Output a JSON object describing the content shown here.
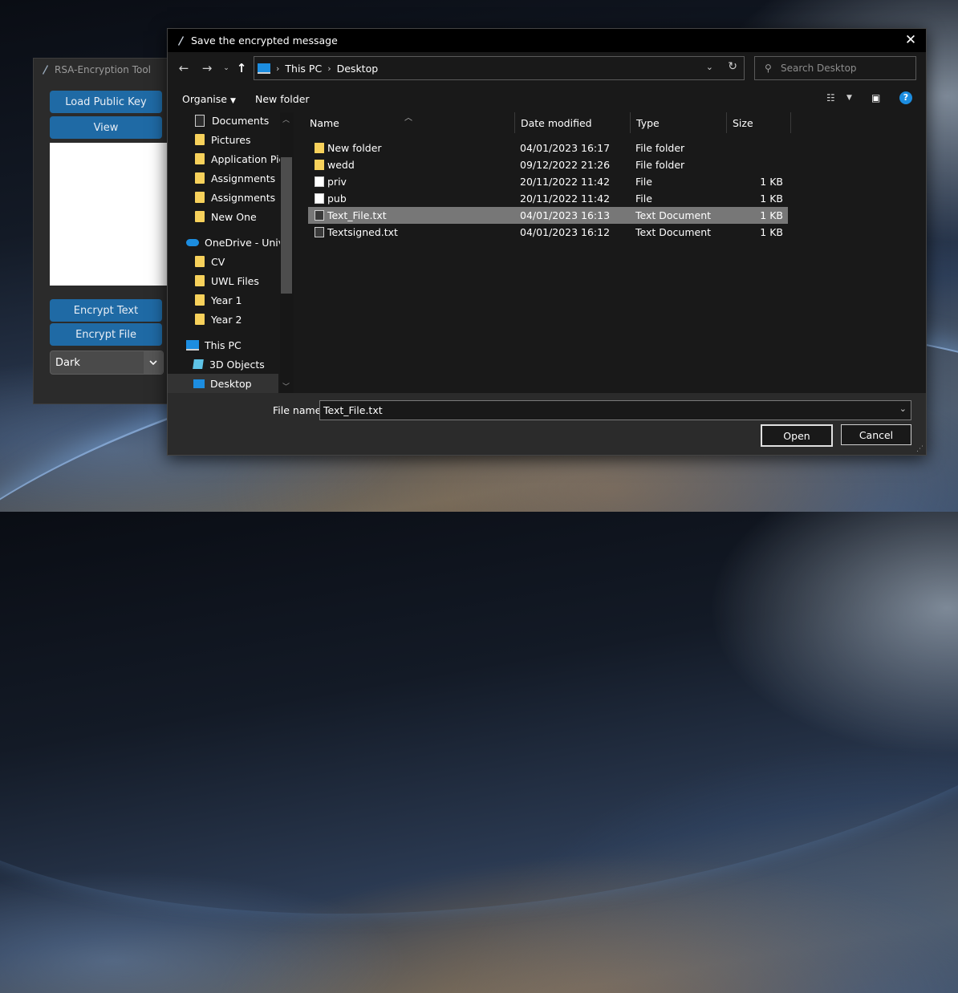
{
  "rsa_app": {
    "title": "RSA-Encryption Tool",
    "load_public_key": "Load Public Key",
    "view": "View",
    "encrypt_text": "Encrypt Text",
    "encrypt_file": "Encrypt File",
    "theme_value": "Dark"
  },
  "dialog": {
    "title": "Save the encrypted message",
    "breadcrumb": [
      "This PC",
      "Desktop"
    ],
    "search_placeholder": "Search Desktop",
    "organise": "Organise",
    "new_folder": "New folder",
    "nav_items": [
      {
        "label": "Documents",
        "icon": "document-icon",
        "pinned": true
      },
      {
        "label": "Pictures",
        "icon": "folder-icon",
        "pinned": true
      },
      {
        "label": "Application Pictu",
        "icon": "folder-icon"
      },
      {
        "label": "Assignments",
        "icon": "folder-icon"
      },
      {
        "label": "Assignments",
        "icon": "folder-icon"
      },
      {
        "label": "New One",
        "icon": "folder-icon"
      },
      {
        "label": "OneDrive - Univer",
        "icon": "onedrive-icon"
      },
      {
        "label": "CV",
        "icon": "folder-icon"
      },
      {
        "label": "UWL Files",
        "icon": "folder-icon"
      },
      {
        "label": "Year 1",
        "icon": "folder-icon"
      },
      {
        "label": "Year 2",
        "icon": "folder-icon"
      },
      {
        "label": "This PC",
        "icon": "pc-icon"
      },
      {
        "label": "3D Objects",
        "icon": "3d-objects-icon"
      },
      {
        "label": "Desktop",
        "icon": "desktop-icon",
        "selected": true
      }
    ],
    "columns": [
      "Name",
      "Date modified",
      "Type",
      "Size"
    ],
    "files": [
      {
        "name": "New folder",
        "date": "04/01/2023 16:17",
        "type": "File folder",
        "size": "",
        "kind": "folder"
      },
      {
        "name": "wedd",
        "date": "09/12/2022 21:26",
        "type": "File folder",
        "size": "",
        "kind": "folder"
      },
      {
        "name": "priv",
        "date": "20/11/2022 11:42",
        "type": "File",
        "size": "1 KB",
        "kind": "file"
      },
      {
        "name": "pub",
        "date": "20/11/2022 11:42",
        "type": "File",
        "size": "1 KB",
        "kind": "file"
      },
      {
        "name": "Text_File.txt",
        "date": "04/01/2023 16:13",
        "type": "Text Document",
        "size": "1 KB",
        "kind": "txt",
        "selected": true
      },
      {
        "name": "Textsigned.txt",
        "date": "04/01/2023 16:12",
        "type": "Text Document",
        "size": "1 KB",
        "kind": "txt"
      }
    ],
    "file_name_label": "File name:",
    "file_name_value": "Text_File.txt",
    "open_label": "Open",
    "cancel_label": "Cancel"
  }
}
